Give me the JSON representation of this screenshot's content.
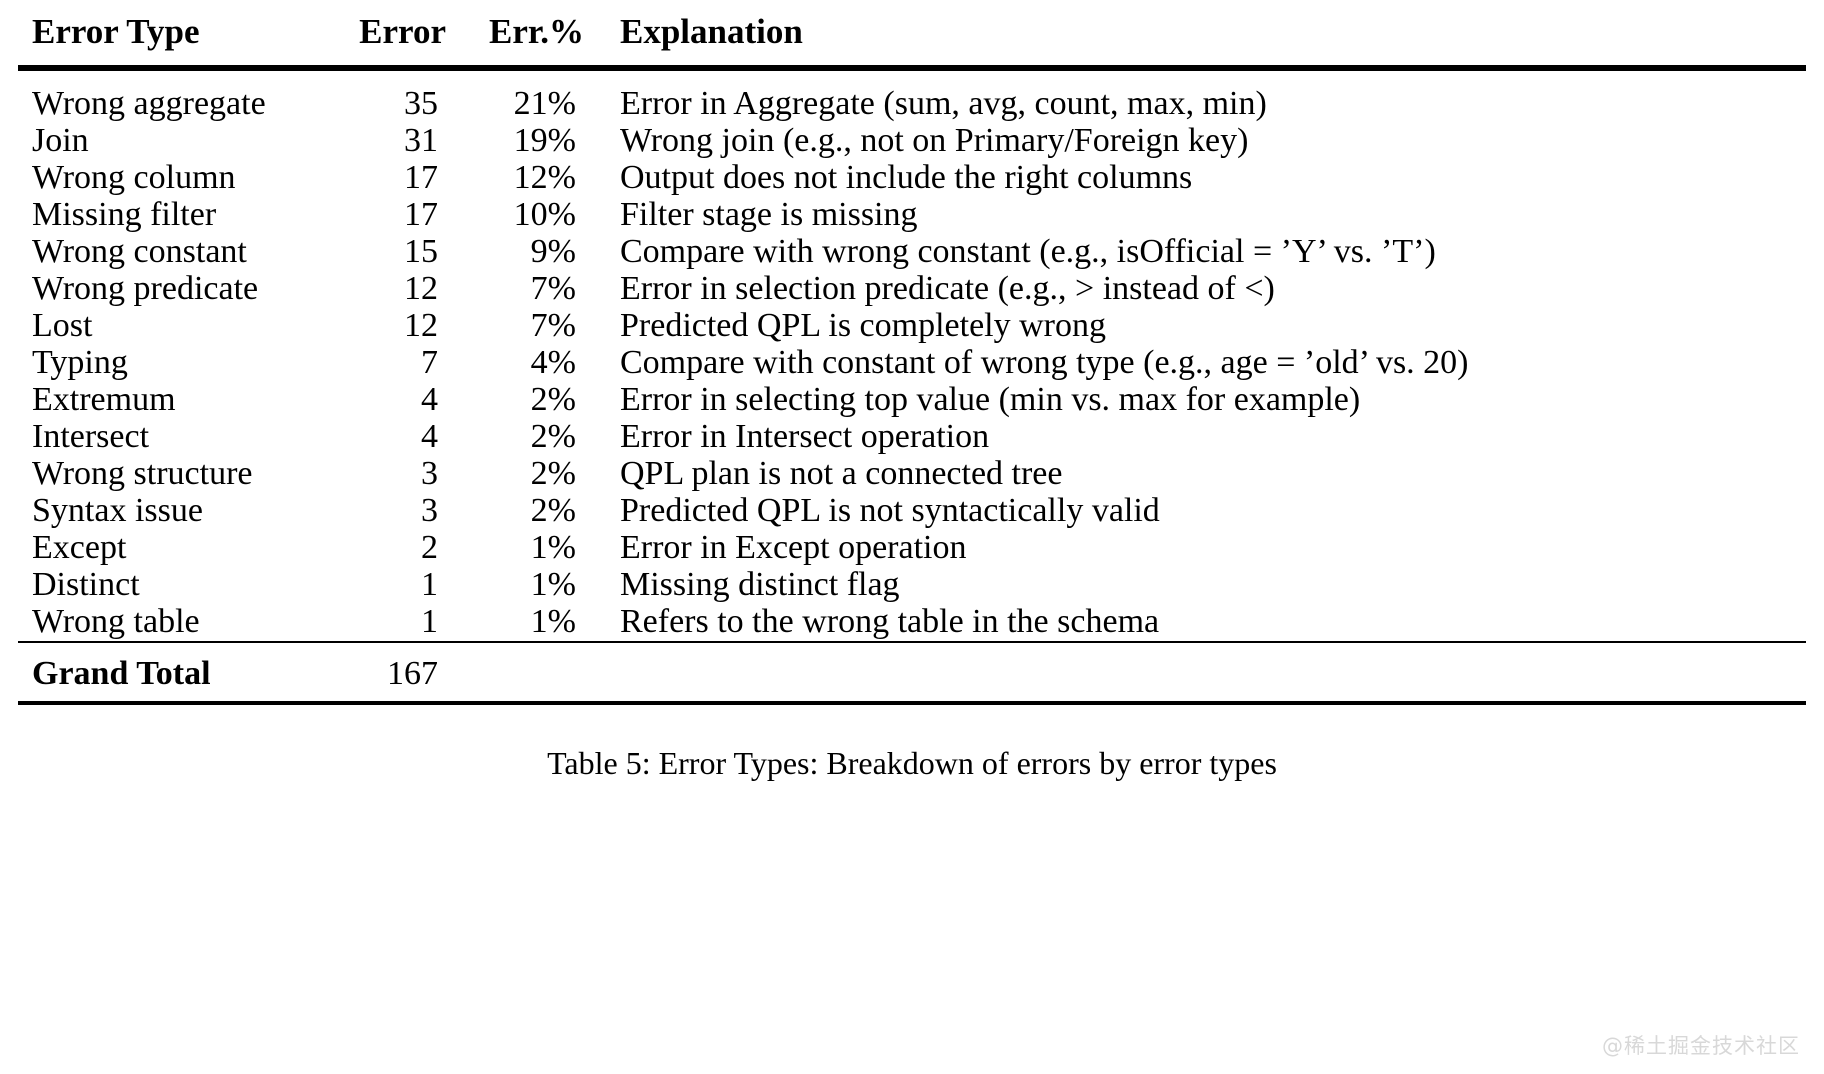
{
  "table": {
    "columns": [
      "Error Type",
      "Error",
      "Err.%",
      "Explanation"
    ],
    "rows": [
      {
        "type": "Wrong aggregate",
        "error": "35",
        "pct": "21%",
        "explanation": "Error in Aggregate (sum, avg, count, max, min)"
      },
      {
        "type": "Join",
        "error": "31",
        "pct": "19%",
        "explanation": "Wrong join (e.g., not on Primary/Foreign key)"
      },
      {
        "type": "Wrong column",
        "error": "17",
        "pct": "12%",
        "explanation": "Output does not include the right columns"
      },
      {
        "type": "Missing filter",
        "error": "17",
        "pct": "10%",
        "explanation": "Filter stage is missing"
      },
      {
        "type": "Wrong constant",
        "error": "15",
        "pct": "9%",
        "explanation": "Compare with wrong constant (e.g., isOfficial = ’Y’ vs. ’T’)"
      },
      {
        "type": "Wrong predicate",
        "error": "12",
        "pct": "7%",
        "explanation": "Error in selection predicate (e.g., > instead of <)"
      },
      {
        "type": "Lost",
        "error": "12",
        "pct": "7%",
        "explanation": "Predicted QPL is completely wrong"
      },
      {
        "type": "Typing",
        "error": "7",
        "pct": "4%",
        "explanation": "Compare with constant of wrong type (e.g., age = ’old’ vs. 20)"
      },
      {
        "type": "Extremum",
        "error": "4",
        "pct": "2%",
        "explanation": "Error in selecting top value (min vs. max for example)"
      },
      {
        "type": "Intersect",
        "error": "4",
        "pct": "2%",
        "explanation": "Error in Intersect operation"
      },
      {
        "type": "Wrong structure",
        "error": "3",
        "pct": "2%",
        "explanation": "QPL plan is not a connected tree"
      },
      {
        "type": "Syntax issue",
        "error": "3",
        "pct": "2%",
        "explanation": "Predicted QPL is not syntactically valid"
      },
      {
        "type": "Except",
        "error": "2",
        "pct": "1%",
        "explanation": "Error in Except operation"
      },
      {
        "type": "Distinct",
        "error": "1",
        "pct": "1%",
        "explanation": "Missing distinct flag"
      },
      {
        "type": "Wrong table",
        "error": "1",
        "pct": "1%",
        "explanation": "Refers to the wrong table in the schema"
      }
    ],
    "total": {
      "type": "Grand Total",
      "error": "167",
      "pct": "",
      "explanation": ""
    }
  },
  "caption": "Table 5: Error Types: Breakdown of errors by error types",
  "watermark": "@稀土掘金技术社区",
  "chart_data": {
    "type": "table",
    "title": "Table 5: Error Types: Breakdown of errors by error types",
    "columns": [
      "Error Type",
      "Error",
      "Err.%",
      "Explanation"
    ],
    "categories": [
      "Wrong aggregate",
      "Join",
      "Wrong column",
      "Missing filter",
      "Wrong constant",
      "Wrong predicate",
      "Lost",
      "Typing",
      "Extremum",
      "Intersect",
      "Wrong structure",
      "Syntax issue",
      "Except",
      "Distinct",
      "Wrong table"
    ],
    "values": [
      35,
      31,
      17,
      17,
      15,
      12,
      12,
      7,
      4,
      4,
      3,
      3,
      2,
      1,
      1
    ],
    "percentages": [
      21,
      19,
      12,
      10,
      9,
      7,
      7,
      4,
      2,
      2,
      2,
      2,
      1,
      1,
      1
    ],
    "total": 167,
    "xlabel": "Error Type",
    "ylabel": "Error"
  }
}
